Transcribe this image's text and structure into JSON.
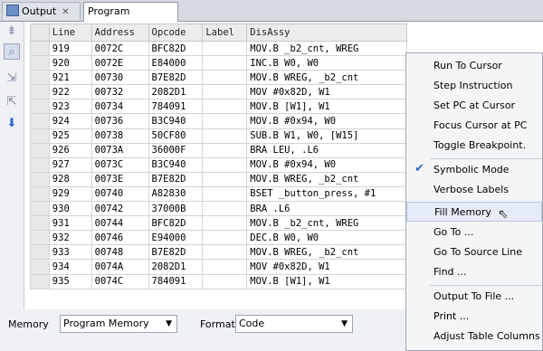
{
  "tabs": [
    {
      "label": "Output",
      "close": "✕"
    },
    {
      "label": "Program Memory",
      "close": "✕"
    }
  ],
  "table": {
    "headers": [
      "Line",
      "Address",
      "Opcode",
      "Label",
      "DisAssy"
    ],
    "rows": [
      [
        "919",
        "0072C",
        "BFC82D",
        "",
        "MOV.B _b2_cnt, WREG"
      ],
      [
        "920",
        "0072E",
        "E84000",
        "",
        "INC.B W0, W0"
      ],
      [
        "921",
        "00730",
        "B7E82D",
        "",
        "MOV.B WREG, _b2_cnt"
      ],
      [
        "922",
        "00732",
        "2082D1",
        "",
        "MOV #0x82D, W1"
      ],
      [
        "923",
        "00734",
        "784091",
        "",
        "MOV.B [W1], W1"
      ],
      [
        "924",
        "00736",
        "B3C940",
        "",
        "MOV.B #0x94, W0"
      ],
      [
        "925",
        "00738",
        "50CF80",
        "",
        "SUB.B W1, W0, [W15]"
      ],
      [
        "926",
        "0073A",
        "36000F",
        "",
        "BRA LEU, .L6"
      ],
      [
        "927",
        "0073C",
        "B3C940",
        "",
        "MOV.B #0x94, W0"
      ],
      [
        "928",
        "0073E",
        "B7E82D",
        "",
        "MOV.B WREG, _b2_cnt"
      ],
      [
        "929",
        "00740",
        "A82830",
        "",
        "BSET _button_press, #1"
      ],
      [
        "930",
        "00742",
        "37000B",
        "",
        "BRA .L6"
      ],
      [
        "931",
        "00744",
        "BFC82D",
        "",
        "MOV.B _b2_cnt, WREG"
      ],
      [
        "932",
        "00746",
        "E94000",
        "",
        "DEC.B W0, W0"
      ],
      [
        "933",
        "00748",
        "B7E82D",
        "",
        "MOV.B WREG, _b2_cnt"
      ],
      [
        "934",
        "0074A",
        "2082D1",
        "",
        "MOV #0x82D, W1"
      ],
      [
        "935",
        "0074C",
        "784091",
        "",
        "MOV.B [W1], W1"
      ]
    ]
  },
  "bottom": {
    "memory_label": "Memory",
    "memory_value": "Program Memory",
    "format_label": "Format",
    "format_value": "Code"
  },
  "context_menu": {
    "items": [
      "Run To Cursor",
      "Step Instruction",
      "Set PC at Cursor",
      "Focus Cursor at PC",
      "Toggle Breakpoint.",
      "Symbolic Mode",
      "Verbose Labels",
      "Fill Memory",
      "Go To ...",
      "Go To Source Line",
      "Find ...",
      "Output To File ...",
      "Print ...",
      "Adjust Table Columns"
    ],
    "checked_item": "Symbolic Mode",
    "highlighted_item": "Fill Memory"
  },
  "icons": {
    "tool1": "step-icon",
    "tool2": "search-icon",
    "tool3": "step-over-icon",
    "tool4": "step-out-icon",
    "tool5": "down-arrow-icon"
  }
}
